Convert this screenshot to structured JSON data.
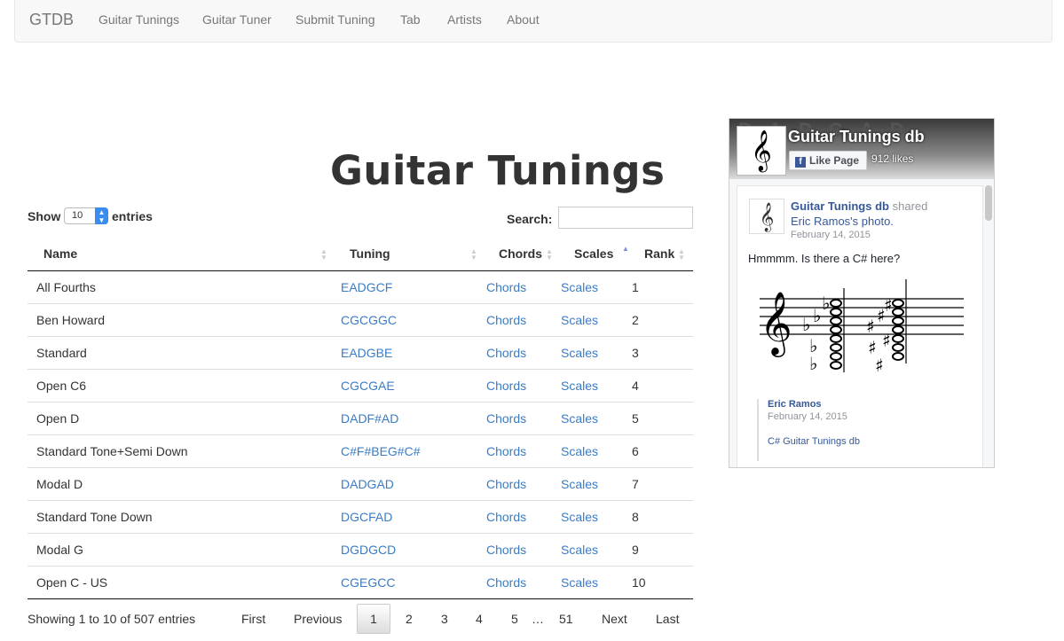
{
  "navbar": {
    "brand": "GTDB",
    "links": [
      "Guitar Tunings",
      "Guitar Tuner",
      "Submit Tuning",
      "Tab",
      "Artists",
      "About"
    ]
  },
  "page_title": "Guitar Tunings",
  "table_controls": {
    "show_label": "Show",
    "length_value": "10",
    "entries_label": "entries",
    "search_label": "Search:",
    "search_value": ""
  },
  "table": {
    "columns": [
      "Name",
      "Tuning",
      "Chords",
      "Scales",
      "Rank"
    ],
    "sorted_column": "Scales",
    "rows": [
      {
        "name": "All Fourths",
        "tuning": "EADGCF",
        "chords": "Chords",
        "scales": "Scales",
        "rank": "1"
      },
      {
        "name": "Ben Howard",
        "tuning": "CGCGGC",
        "chords": "Chords",
        "scales": "Scales",
        "rank": "2"
      },
      {
        "name": "Standard",
        "tuning": "EADGBE",
        "chords": "Chords",
        "scales": "Scales",
        "rank": "3"
      },
      {
        "name": "Open C6",
        "tuning": "CGCGAE",
        "chords": "Chords",
        "scales": "Scales",
        "rank": "4"
      },
      {
        "name": "Open D",
        "tuning": "DADF#AD",
        "chords": "Chords",
        "scales": "Scales",
        "rank": "5"
      },
      {
        "name": "Standard Tone+Semi Down",
        "tuning": "C#F#BEG#C#",
        "chords": "Chords",
        "scales": "Scales",
        "rank": "6"
      },
      {
        "name": "Modal D",
        "tuning": "DADGAD",
        "chords": "Chords",
        "scales": "Scales",
        "rank": "7"
      },
      {
        "name": "Standard Tone Down",
        "tuning": "DGCFAD",
        "chords": "Chords",
        "scales": "Scales",
        "rank": "8"
      },
      {
        "name": "Modal G",
        "tuning": "DGDGCD",
        "chords": "Chords",
        "scales": "Scales",
        "rank": "9"
      },
      {
        "name": "Open C - US",
        "tuning": "CGEGCC",
        "chords": "Chords",
        "scales": "Scales",
        "rank": "10"
      }
    ]
  },
  "table_info": "Showing 1 to 10 of 507 entries",
  "pagination": {
    "first": "First",
    "previous": "Previous",
    "pages": [
      "1",
      "2",
      "3",
      "4",
      "5"
    ],
    "ellipsis": "…",
    "last_page": "51",
    "next": "Next",
    "last": "Last",
    "current": "1"
  },
  "facebook": {
    "page_name": "Guitar Tunings db",
    "like_button": "Like Page",
    "likes": "912 likes",
    "post": {
      "author": "Guitar Tunings db",
      "action": "shared",
      "shared_from": "Eric Ramos's photo.",
      "date": "February 14, 2015",
      "text": "Hmmmm. Is there a C# here?",
      "quote_author": "Eric Ramos",
      "quote_date": "February 14, 2015",
      "quote_link": "C# Guitar Tunings db"
    }
  },
  "colors": {
    "link": "#3a7cc6",
    "navbar_bg": "#f8f8f8",
    "fb_blue": "#365899",
    "sort_active": "#7f8bd6"
  }
}
